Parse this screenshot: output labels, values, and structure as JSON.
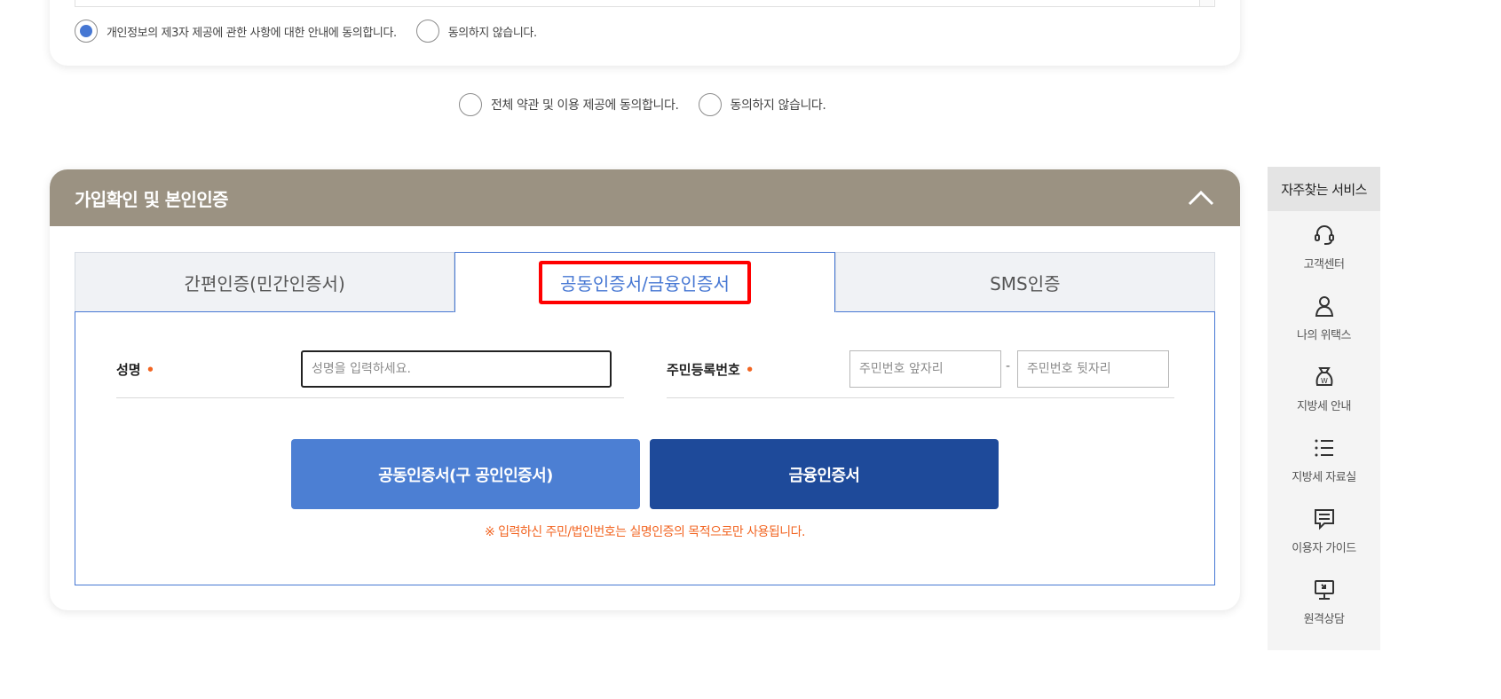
{
  "consent_third_party": {
    "agree_label": "개인정보의 제3자 제공에 관한 사항에 대한 안내에 동의합니다.",
    "disagree_label": "동의하지 않습니다."
  },
  "consent_all": {
    "agree_label": "전체 약관 및 이용 제공에 동의합니다.",
    "disagree_label": "동의하지 않습니다."
  },
  "auth_section": {
    "title": "가입확인 및 본인인증",
    "tabs": [
      {
        "label": "간편인증(민간인증서)"
      },
      {
        "label": "공동인증서/금융인증서"
      },
      {
        "label": "SMS인증"
      }
    ],
    "active_tab": 1,
    "name_label": "성명",
    "name_placeholder": "성명을 입력하세요.",
    "rrn_label": "주민등록번호",
    "rrn_front_placeholder": "주민번호 앞자리",
    "rrn_separator": "-",
    "rrn_back_placeholder": "주민번호 뒷자리",
    "required_mark": "•",
    "joint_cert_button": "공동인증서(구 공인인증서)",
    "finance_cert_button": "금융인증서",
    "notice": "※ 입력하신 주민/법인번호는 실명인증의 목적으로만 사용됩니다."
  },
  "quickbar": {
    "title": "자주찾는 서비스",
    "items": [
      {
        "label": "고객센터",
        "icon": "headset-icon"
      },
      {
        "label": "나의 위택스",
        "icon": "user-icon"
      },
      {
        "label": "지방세 안내",
        "icon": "money-bag-icon"
      },
      {
        "label": "지방세 자료실",
        "icon": "list-icon"
      },
      {
        "label": "이용자 가이드",
        "icon": "chat-icon"
      },
      {
        "label": "원격상담",
        "icon": "remote-monitor-icon"
      }
    ]
  },
  "colors": {
    "header_bg": "#9b9282",
    "accent_blue": "#4677d3",
    "button_light": "#4c7fd3",
    "button_dark": "#1e4a9a",
    "notice_orange": "#f26522",
    "highlight_red": "#ff0000"
  }
}
